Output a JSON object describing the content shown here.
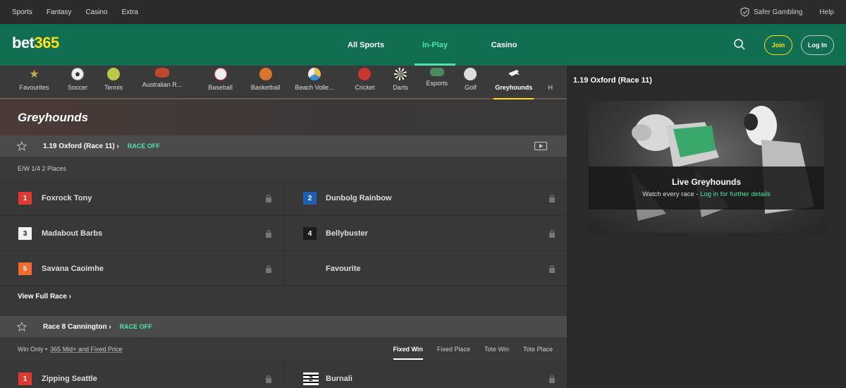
{
  "topbar": {
    "links": [
      "Sports",
      "Fantasy",
      "Casino",
      "Extra"
    ],
    "safer_gambling": "Safer Gambling",
    "help": "Help"
  },
  "header": {
    "logo_part1": "bet",
    "logo_part2": "365",
    "nav": [
      "All Sports",
      "In-Play",
      "Casino"
    ],
    "active_nav": "In-Play",
    "join": "Join",
    "login": "Log In"
  },
  "sports": [
    {
      "label": "Favourites",
      "icon": "star-icon"
    },
    {
      "label": "Soccer",
      "icon": "soccer-ball-icon"
    },
    {
      "label": "Tennis",
      "icon": "tennis-ball-icon"
    },
    {
      "label": "Australian R...",
      "icon": "australian-rules-icon"
    },
    {
      "label": "Baseball",
      "icon": "baseball-icon"
    },
    {
      "label": "Basketball",
      "icon": "basketball-icon"
    },
    {
      "label": "Beach Volle...",
      "icon": "beach-volleyball-icon"
    },
    {
      "label": "Cricket",
      "icon": "cricket-ball-icon"
    },
    {
      "label": "Darts",
      "icon": "dartboard-icon"
    },
    {
      "label": "Esports",
      "icon": "gamepad-icon"
    },
    {
      "label": "Golf",
      "icon": "golf-ball-icon"
    },
    {
      "label": "Greyhounds",
      "icon": "greyhound-icon"
    },
    {
      "label": "H",
      "icon": ""
    }
  ],
  "page_title": "Greyhounds",
  "race1": {
    "name": "1.19 Oxford (Race 11) ›",
    "status": "RACE OFF",
    "terms": "E/W 1/4 2 Places",
    "runners": [
      {
        "num": "1",
        "name": "Foxrock Tony",
        "bg": "#e03a30",
        "fg": "#ffffff"
      },
      {
        "num": "2",
        "name": "Dunbolg Rainbow",
        "bg": "#1e5fb4",
        "fg": "#ffffff"
      },
      {
        "num": "3",
        "name": "Madabout Barbs",
        "bg": "#f2f2f2",
        "fg": "#222222"
      },
      {
        "num": "4",
        "name": "Bellybuster",
        "bg": "#1c1c1c",
        "fg": "#ffffff"
      },
      {
        "num": "5",
        "name": "Savana Caoimhe",
        "bg": "#f26a30",
        "fg": "#ffffff"
      },
      {
        "num": "",
        "name": "Favourite",
        "bg": "",
        "fg": ""
      }
    ],
    "view_full": "View Full Race ›"
  },
  "race2": {
    "name": "Race 8 Cannington ›",
    "status": "RACE OFF",
    "terms_a": "Win Only •",
    "terms_b": "365 Mid+ and Fixed Price",
    "tabs": [
      "Fixed Win",
      "Fixed Place",
      "Tote Win",
      "Tote Place"
    ],
    "runners": [
      {
        "num": "1",
        "name": "Zipping Seattle",
        "bg": "#e03a30",
        "fg": "#ffffff"
      },
      {
        "num": "2",
        "name": "Burnali",
        "bg": "#ffffff",
        "fg": "#111111"
      }
    ]
  },
  "right": {
    "title": "1.19 Oxford (Race 11)",
    "video_title": "Live Greyhounds",
    "video_sub": "Watch every race - ",
    "video_link": "Log in for further details"
  }
}
